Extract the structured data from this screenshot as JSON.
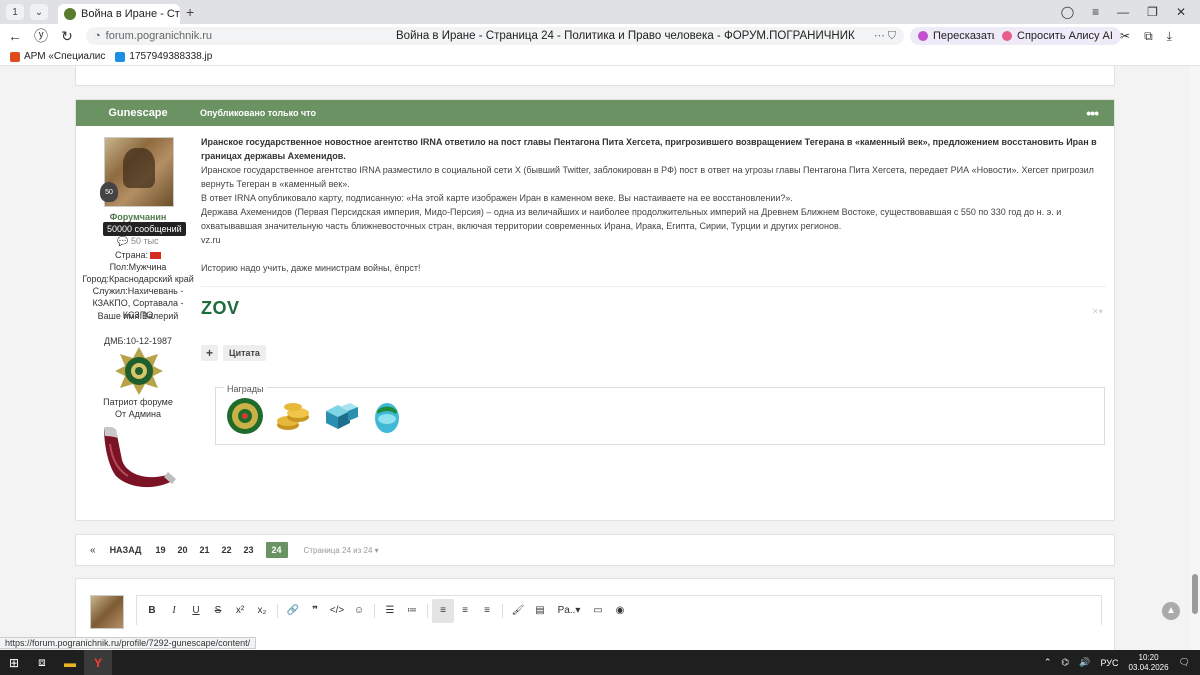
{
  "browser": {
    "tab_counter": "1",
    "tab_title": "Война в Иране - Страни",
    "tab_close": "✕",
    "new_tab": "+",
    "url": "forum.pogranichnik.ru",
    "page_title": "Война в Иране - Страница 24 - Политика и Право человека - ФОРУМ.ПОГРАНИЧНИК",
    "retell_label": "Пересказать",
    "alice_label": "Спросить Алису AI",
    "bookmarks": [
      {
        "label": "АРМ «Специалис"
      },
      {
        "label": "1757949388338.jp"
      }
    ]
  },
  "post": {
    "author": "Gunescape",
    "date": "Опубликовано только что",
    "menu": "•••",
    "rank": "Форумчанин",
    "tooltip": "50000 сообщений",
    "postcount": "50 тыс",
    "country": "Страна:",
    "gender": "Пол:Мужчина",
    "city": "Город:Краснодарский край",
    "served": "Служил:Нахичевань - КЗАКПО, Сортавала - КСЗПО",
    "name": "Ваше имя:Валерий",
    "dmb": "ДМБ:10-12-1987",
    "patriot": "Патриот форуме",
    "from_admin": "От Админа",
    "kettle_num": "50",
    "lead": "Иранское государственное новостное агентство IRNA ответило на пост главы Пентагона Пита Хегсета, пригрозившего возвращением Тегерана в «каменный век», предложением восстановить Иран в границах державы Ахеменидов.",
    "p1": "Иранское государственное агентство IRNA разместило в социальной сети X (бывший Twitter, заблокирован в РФ) пост в ответ на угрозы главы Пентагона Пита Хегсета, передает РИА «Новости». Хегсет пригрозил вернуть Тегеран в «каменный век».",
    "p2": "В ответ IRNA опубликовало карту, подписанную: «На этой карте изображен Иран в каменном веке. Вы настаиваете на ее восстановлении?».",
    "p3": "Держава Ахеменидов (Первая Персидская империя, Мидо-Персия) – одна из величайших и наиболее продолжительных империй на Древнем Ближнем Востоке, существовавшая с 550 по 330 год до н. э. и охватывавшая значительную часть ближневосточных стран, включая территории современных Ирана, Ирака, Египта, Сирии, Турции и других регионов.",
    "source": "vz.ru",
    "comment": "Историю надо учить, даже министрам войны, ёпрст!",
    "signature": "ZOV",
    "plus": "+",
    "quote": "Цитата",
    "awards_title": "Награды"
  },
  "pager": {
    "first": "«",
    "back": "НАЗАД",
    "pages": [
      "19",
      "20",
      "21",
      "22",
      "23"
    ],
    "current": "24",
    "info": "Страница 24 из 24 ▾"
  },
  "status_url": "https://forum.pogranichnik.ru/profile/7292-gunescape/content/",
  "taskbar": {
    "lang": "РУС",
    "time": "10:20",
    "date": "03.04.2026"
  },
  "colors": {
    "header_green": "#6b9262",
    "signature_green": "#1d6a3c"
  }
}
